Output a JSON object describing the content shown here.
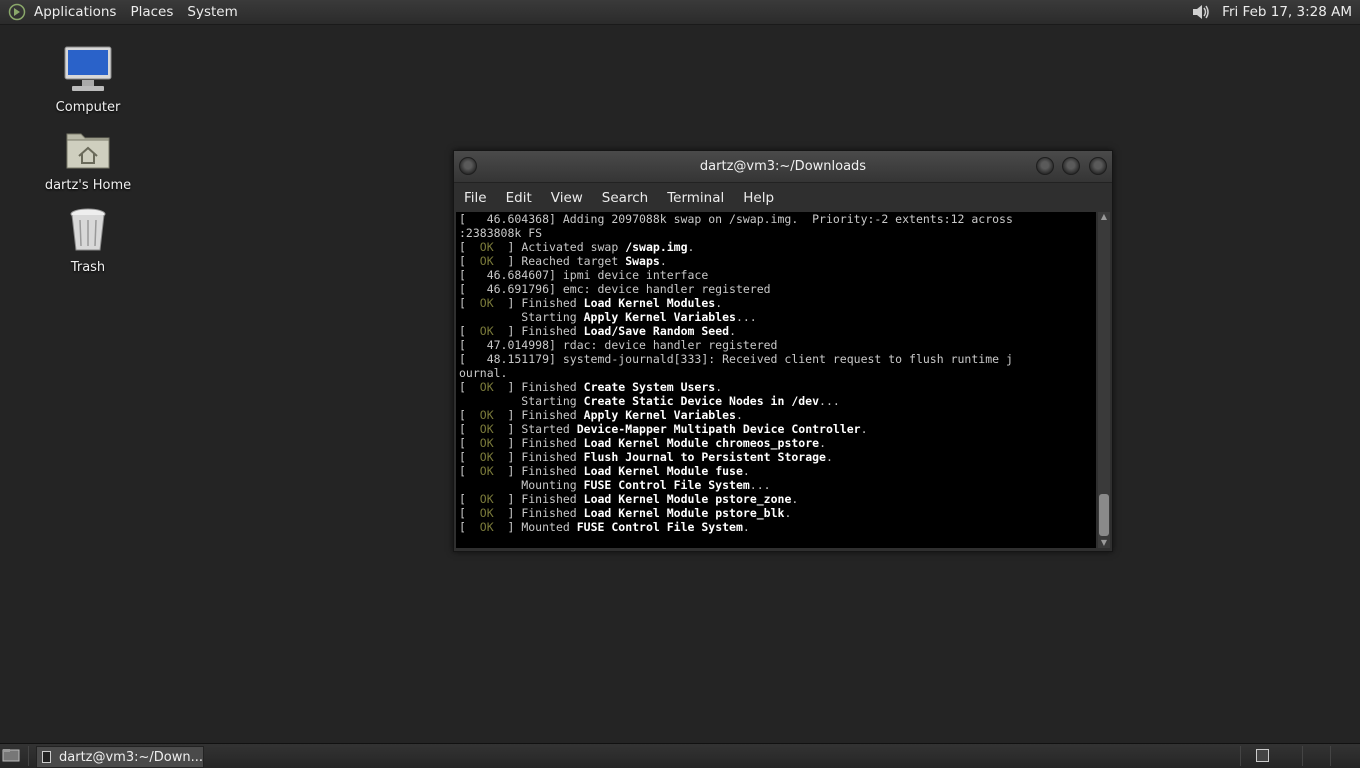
{
  "top_panel": {
    "menus": [
      "Applications",
      "Places",
      "System"
    ],
    "clock": "Fri Feb 17,  3:28 AM"
  },
  "desktop": {
    "icons": [
      {
        "label": "Computer",
        "icon": "computer-icon"
      },
      {
        "label": "dartz's Home",
        "icon": "home-folder-icon"
      },
      {
        "label": "Trash",
        "icon": "trash-icon"
      }
    ]
  },
  "terminal": {
    "title": "dartz@vm3:~/Downloads",
    "menus": [
      "File",
      "Edit",
      "View",
      "Search",
      "Terminal",
      "Help"
    ],
    "lines": [
      [
        {
          "t": "[   46.604368] Adding 2097088k swap on /swap.img.  Priority:-2 extents:12 across"
        }
      ],
      [
        {
          "t": ":2383808k FS"
        }
      ],
      [
        {
          "t": "[  "
        },
        {
          "t": "OK",
          "s": "ok"
        },
        {
          "t": "  ] Activated swap "
        },
        {
          "t": "/swap.img",
          "s": "b"
        },
        {
          "t": "."
        }
      ],
      [
        {
          "t": "[  "
        },
        {
          "t": "OK",
          "s": "ok"
        },
        {
          "t": "  ] Reached target "
        },
        {
          "t": "Swaps",
          "s": "b"
        },
        {
          "t": "."
        }
      ],
      [
        {
          "t": "[   46.684607] ipmi device interface"
        }
      ],
      [
        {
          "t": "[   46.691796] emc: device handler registered"
        }
      ],
      [
        {
          "t": "[  "
        },
        {
          "t": "OK",
          "s": "ok"
        },
        {
          "t": "  ] Finished "
        },
        {
          "t": "Load Kernel Modules",
          "s": "b"
        },
        {
          "t": "."
        }
      ],
      [
        {
          "t": "         Starting "
        },
        {
          "t": "Apply Kernel Variables",
          "s": "b"
        },
        {
          "t": "..."
        }
      ],
      [
        {
          "t": "[  "
        },
        {
          "t": "OK",
          "s": "ok"
        },
        {
          "t": "  ] Finished "
        },
        {
          "t": "Load/Save Random Seed",
          "s": "b"
        },
        {
          "t": "."
        }
      ],
      [
        {
          "t": "[   47.014998] rdac: device handler registered"
        }
      ],
      [
        {
          "t": "[   48.151179] systemd-journald[333]: Received client request to flush runtime j"
        }
      ],
      [
        {
          "t": "ournal."
        }
      ],
      [
        {
          "t": "[  "
        },
        {
          "t": "OK",
          "s": "ok"
        },
        {
          "t": "  ] Finished "
        },
        {
          "t": "Create System Users",
          "s": "b"
        },
        {
          "t": "."
        }
      ],
      [
        {
          "t": "         Starting "
        },
        {
          "t": "Create Static Device Nodes in /dev",
          "s": "b"
        },
        {
          "t": "..."
        }
      ],
      [
        {
          "t": "[  "
        },
        {
          "t": "OK",
          "s": "ok"
        },
        {
          "t": "  ] Finished "
        },
        {
          "t": "Apply Kernel Variables",
          "s": "b"
        },
        {
          "t": "."
        }
      ],
      [
        {
          "t": "[  "
        },
        {
          "t": "OK",
          "s": "ok"
        },
        {
          "t": "  ] Started "
        },
        {
          "t": "Device-Mapper Multipath Device Controller",
          "s": "b"
        },
        {
          "t": "."
        }
      ],
      [
        {
          "t": "[  "
        },
        {
          "t": "OK",
          "s": "ok"
        },
        {
          "t": "  ] Finished "
        },
        {
          "t": "Load Kernel Module chromeos_pstore",
          "s": "b"
        },
        {
          "t": "."
        }
      ],
      [
        {
          "t": "[  "
        },
        {
          "t": "OK",
          "s": "ok"
        },
        {
          "t": "  ] Finished "
        },
        {
          "t": "Flush Journal to Persistent Storage",
          "s": "b"
        },
        {
          "t": "."
        }
      ],
      [
        {
          "t": "[  "
        },
        {
          "t": "OK",
          "s": "ok"
        },
        {
          "t": "  ] Finished "
        },
        {
          "t": "Load Kernel Module fuse",
          "s": "b"
        },
        {
          "t": "."
        }
      ],
      [
        {
          "t": "         Mounting "
        },
        {
          "t": "FUSE Control File System",
          "s": "b"
        },
        {
          "t": "..."
        }
      ],
      [
        {
          "t": "[  "
        },
        {
          "t": "OK",
          "s": "ok"
        },
        {
          "t": "  ] Finished "
        },
        {
          "t": "Load Kernel Module pstore_zone",
          "s": "b"
        },
        {
          "t": "."
        }
      ],
      [
        {
          "t": "[  "
        },
        {
          "t": "OK",
          "s": "ok"
        },
        {
          "t": "  ] Finished "
        },
        {
          "t": "Load Kernel Module pstore_blk",
          "s": "b"
        },
        {
          "t": "."
        }
      ],
      [
        {
          "t": "[  "
        },
        {
          "t": "OK",
          "s": "ok"
        },
        {
          "t": "  ] Mounted "
        },
        {
          "t": "FUSE Control File System",
          "s": "b"
        },
        {
          "t": "."
        }
      ]
    ]
  },
  "taskbar": {
    "task_label": "dartz@vm3:~/Down..."
  }
}
